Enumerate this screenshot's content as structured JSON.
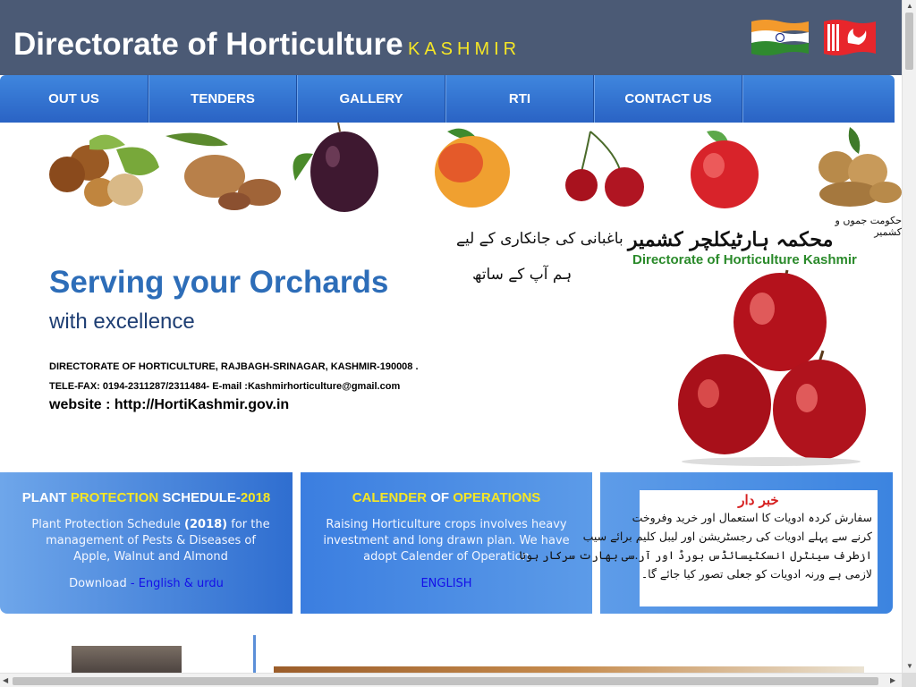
{
  "header": {
    "title": "Directorate of Horticulture",
    "subtitle": "KASHMIR"
  },
  "nav": {
    "items": [
      "OUT US",
      "TENDERS",
      "GALLERY",
      "RTI",
      "CONTACT US"
    ]
  },
  "banner": {
    "tagline_main": "Serving your Orchards",
    "tagline_sub": "with excellence",
    "address": "DIRECTORATE OF HORTICULTURE, RAJBAGH-SRINAGAR, KASHMIR-190008 .",
    "telefax": "TELE-FAX: 0194-2311287/2311484- E-mail :Kashmirhorticulture@gmail.com",
    "website": "website : http://HortiKashmir.gov.in",
    "urdu_slogan_1": "باغبانی کی جانکاری کے لیے",
    "urdu_slogan_2": "ہم آپ کے ساتھ",
    "urdu_govt": "حکومت جموں و کشمیر",
    "urdu_dept": "محکمہ ہارٹیکلچر کشمیر",
    "dept_english": "Directorate of Horticulture Kashmir"
  },
  "boxes": {
    "plant": {
      "title_a": "PLANT ",
      "title_b": "PROTECTION",
      "title_c": " SCHEDULE-",
      "title_d": "2018",
      "text_a": "Plant Protection Schedule ",
      "text_b": "(2018)",
      "text_c": " for the management of Pests & Diseases of Apple, Walnut and Almond",
      "download_label": "Download",
      "download_sep": " - ",
      "download_link": "English & urdu"
    },
    "calendar": {
      "title_a": "CALENDER",
      "title_b": " OF ",
      "title_c": "OPERATIONS",
      "text": "Raising Horticulture crops involves heavy investment and long drawn plan. We have adopt Calender of Operation",
      "link": "ENGLISH"
    },
    "warning": {
      "title": "خبر دار",
      "lines": [
        "سفارش کردہ ادویات کا استعمال اور خرید وفروخت",
        "کرنے سے پہلے ادویات کی رجسٹریشن اور لیبل کلیم برائے سیب",
        "ازطرف سینٹرل انسکٹیسائڈس بورڈ اور آر.سی بھارت سرکار ہونا",
        "لازمی ہے ورنہ ادویات کو جعلی تصور کیا جائے گا۔"
      ]
    }
  },
  "colors": {
    "header_bg": "#4b5a75",
    "nav_bg": "#2a63c4",
    "title_blue": "#2d6db8",
    "accent_yellow": "#f5e625",
    "link_blue": "#1510e8"
  }
}
